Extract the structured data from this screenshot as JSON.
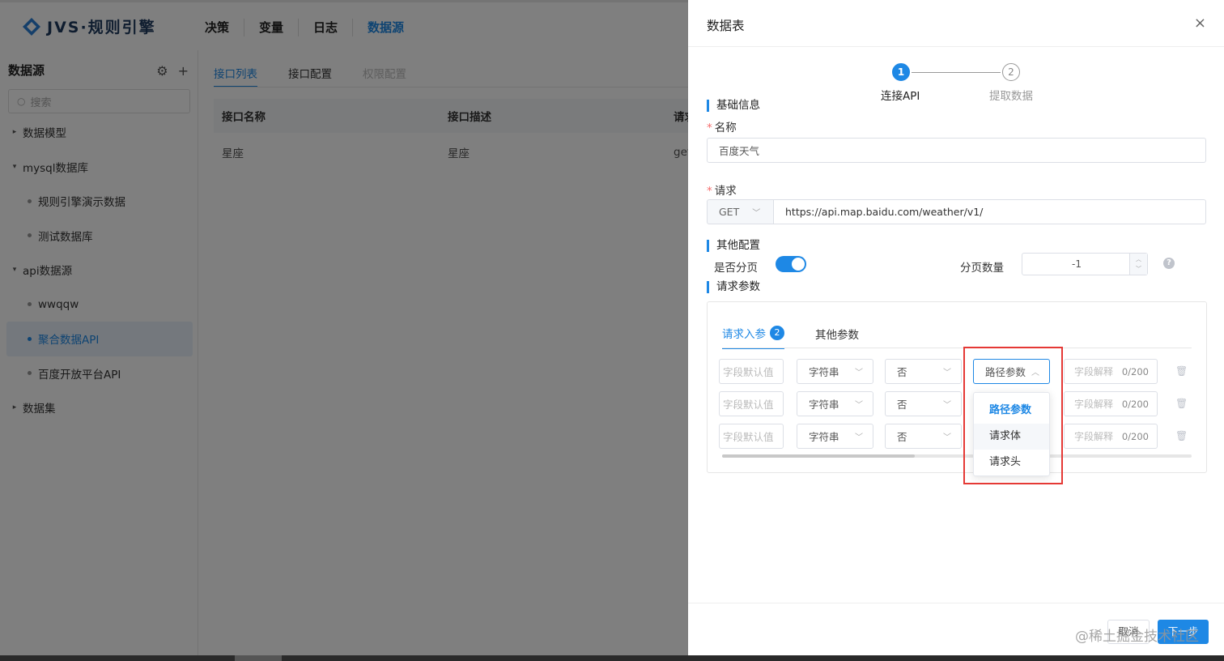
{
  "app": {
    "logo_text": "JVS·规则引擎",
    "nav": [
      "决策",
      "变量",
      "日志",
      "数据源"
    ],
    "active_nav": "数据源"
  },
  "sidebar": {
    "title": "数据源",
    "search_placeholder": "搜索",
    "items": [
      {
        "label": "数据模型",
        "level": 0
      },
      {
        "label": "mysql数据库",
        "level": 0
      },
      {
        "label": "规则引擎演示数据",
        "level": 1
      },
      {
        "label": "测试数据库",
        "level": 1
      },
      {
        "label": "api数据源",
        "level": 0
      },
      {
        "label": "wwqqw",
        "level": 1
      },
      {
        "label": "聚合数据API",
        "level": 1
      },
      {
        "label": "百度开放平台API",
        "level": 1
      },
      {
        "label": "数据集",
        "level": 0
      }
    ]
  },
  "main": {
    "tabs": [
      "接口列表",
      "接口配置",
      "权限配置"
    ],
    "table": {
      "headers": [
        "接口名称",
        "接口描述",
        "请求"
      ],
      "rows": [
        [
          "星座",
          "星座",
          "get"
        ]
      ]
    }
  },
  "drawer": {
    "title": "数据表",
    "close": "×",
    "steps": [
      {
        "num": "1",
        "label": "连接API"
      },
      {
        "num": "2",
        "label": "提取数据"
      }
    ],
    "basic_section": "基础信息",
    "name_label": "名称",
    "name_value": "百度天气",
    "request_label": "请求",
    "method": "GET",
    "url": "https://api.map.baidu.com/weather/v1/",
    "other_section": "其他配置",
    "paging_label": "是否分页",
    "paging_enabled": true,
    "page_size_label": "分页数量",
    "page_size_value": "-1",
    "params_section": "请求参数",
    "param_tabs": {
      "input": "请求入参",
      "input_count": "2",
      "other": "其他参数"
    },
    "rows": [
      {
        "default": "字段默认值",
        "type": "字符串",
        "required": "否",
        "position": "路径参数",
        "desc": "字段解释",
        "count": "0/200"
      },
      {
        "default": "字段默认值",
        "type": "字符串",
        "required": "否",
        "position": "",
        "desc": "字段解释",
        "count": "0/200"
      },
      {
        "default": "字段默认值",
        "type": "字符串",
        "required": "否",
        "position": "",
        "desc": "字段解释",
        "count": "0/200"
      }
    ],
    "dropdown_options": [
      "路径参数",
      "请求体",
      "请求头"
    ],
    "cancel_label": "取消",
    "next_label": "下一步"
  },
  "watermark": "@稀土掘金技术社区",
  "colors": {
    "accent": "#1e88e5",
    "highlight": "#e53935"
  }
}
